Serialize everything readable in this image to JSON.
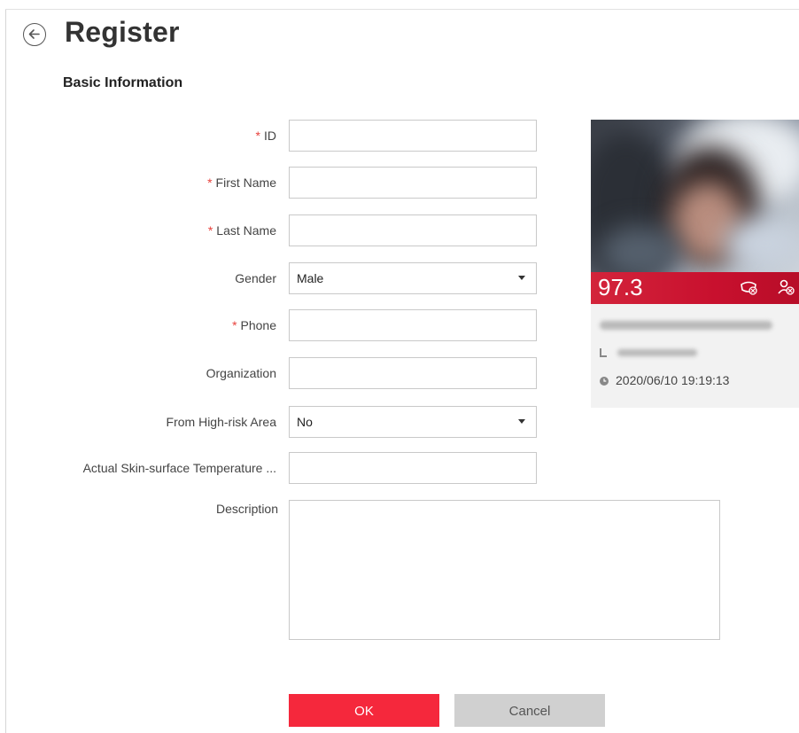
{
  "header": {
    "title": "Register"
  },
  "section": {
    "title": "Basic Information"
  },
  "form": {
    "fields": [
      {
        "label": "ID",
        "required": "*",
        "value": ""
      },
      {
        "label": "First Name",
        "required": "*",
        "value": ""
      },
      {
        "label": "Last Name",
        "required": "*",
        "value": ""
      },
      {
        "label": "Gender",
        "required": "",
        "value": "Male"
      },
      {
        "label": "Phone",
        "required": "*",
        "value": ""
      },
      {
        "label": "Organization",
        "required": "",
        "value": ""
      },
      {
        "label": "From High-risk Area",
        "required": "",
        "value": "No"
      },
      {
        "label": "Actual Skin-surface Temperature ...",
        "required": "",
        "value": ""
      }
    ],
    "description": {
      "label": "Description",
      "value": ""
    }
  },
  "capture_card": {
    "temperature": "97.3",
    "timestamp": "2020/06/10 19:19:13",
    "icons": [
      "no-mask-icon",
      "unauthorized-person-icon",
      "camera-icon",
      "clock-icon"
    ],
    "colors": {
      "alarm_bar": "#c8102e"
    }
  },
  "buttons": {
    "ok": "OK",
    "cancel": "Cancel"
  },
  "colors": {
    "primary": "#f5283c",
    "required": "#e8413c",
    "secondary": "#d0d0d0"
  }
}
